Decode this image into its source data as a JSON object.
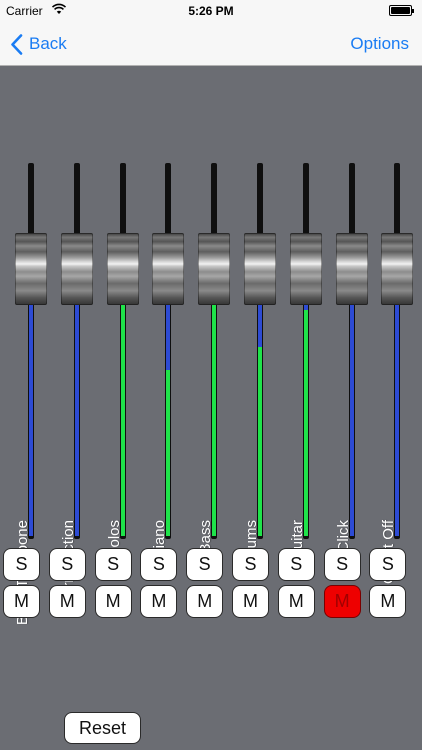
{
  "status_bar": {
    "carrier": "Carrier",
    "time": "5:26 PM",
    "icons": [
      "wifi-icon",
      "battery-icon"
    ]
  },
  "nav": {
    "back_label": "Back",
    "options_label": "Options",
    "accent_color": "#1a7cf3"
  },
  "mixer": {
    "solo_label": "S",
    "mute_label": "M",
    "meter_color": "#1fe34a",
    "level_color": "#2d4bd4",
    "mute_active_color": "#ee0000",
    "channels": [
      {
        "name": "Bass Trombone",
        "level": 0.0,
        "muted": false,
        "soloed": false
      },
      {
        "name": "Horn Section",
        "level": 0.0,
        "muted": false,
        "soloed": false
      },
      {
        "name": "Solos",
        "level": 1.0,
        "muted": false,
        "soloed": false
      },
      {
        "name": "Piano",
        "level": 0.72,
        "muted": false,
        "soloed": false
      },
      {
        "name": "Bass",
        "level": 1.0,
        "muted": false,
        "soloed": false
      },
      {
        "name": "Drums",
        "level": 0.82,
        "muted": false,
        "soloed": false
      },
      {
        "name": "Guitar",
        "level": 0.98,
        "muted": false,
        "soloed": false
      },
      {
        "name": "Click",
        "level": 0.0,
        "muted": true,
        "soloed": false
      },
      {
        "name": "Count Off",
        "level": 0.0,
        "muted": false,
        "soloed": false
      }
    ]
  },
  "footer": {
    "reset_label": "Reset"
  }
}
